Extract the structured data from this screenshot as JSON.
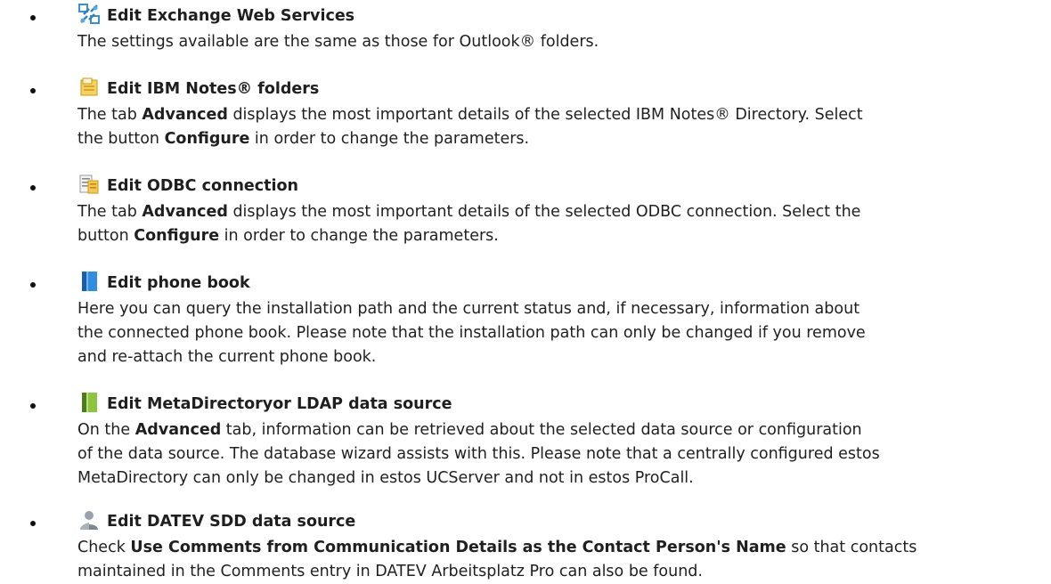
{
  "items": [
    {
      "icon": "exchange-web-services-icon",
      "title": "Edit Exchange Web Services",
      "lines": [
        [
          "The settings available are the same as those for Outlook® folders."
        ]
      ]
    },
    {
      "icon": "ibm-notes-icon",
      "title": "Edit IBM Notes® folders",
      "lines": [
        [
          "The tab ",
          {
            "b": "Advanced"
          },
          " displays the most important details of the selected IBM Notes® Directory. Select"
        ],
        [
          "the button ",
          {
            "b": "Configure"
          },
          " in order to change the parameters."
        ]
      ]
    },
    {
      "icon": "odbc-connection-icon",
      "title": "Edit ODBC connection",
      "lines": [
        [
          "The tab ",
          {
            "b": "Advanced"
          },
          " displays the most important details of the selected ODBC connection. Select the"
        ],
        [
          "button ",
          {
            "b": "Configure"
          },
          " in order to change the parameters."
        ]
      ]
    },
    {
      "icon": "phone-book-icon",
      "title": "Edit phone book",
      "lines": [
        [
          "Here you can query the installation path and the current status and, if necessary, information about"
        ],
        [
          "the connected phone book. Please note that the installation path can only be changed if you remove"
        ],
        [
          "and re-attach the current phone book."
        ]
      ]
    },
    {
      "icon": "metadirectory-ldap-icon",
      "title": "Edit MetaDirectoryor LDAP data source",
      "lines": [
        [
          "On the ",
          {
            "b": "Advanced"
          },
          " tab, information can be retrieved about the selected data source or configuration"
        ],
        [
          "of the data source. The database wizard assists with this. Please note that a centrally configured estos"
        ],
        [
          "MetaDirectory can only be changed in estos UCServer and not in estos ProCall."
        ]
      ]
    },
    {
      "icon": "datev-person-icon",
      "title": "Edit DATEV SDD data source",
      "lines": [
        [
          "Check ",
          {
            "b": "Use Comments from Communication Details as the Contact Person's Name"
          },
          " so that contacts"
        ],
        [
          "maintained in the Comments entry in DATEV Arbeitsplatz Pro can also be found."
        ]
      ]
    }
  ]
}
